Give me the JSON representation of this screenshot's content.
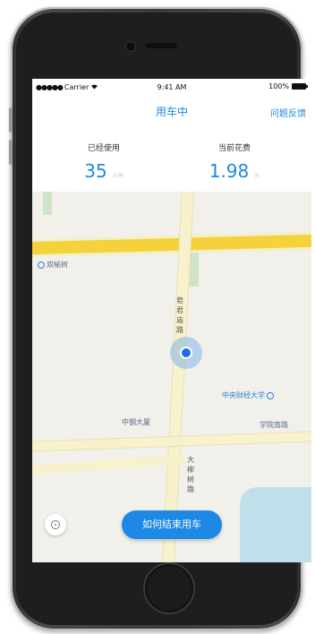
{
  "status_bar": {
    "carrier": "Carrier",
    "time": "9:41 AM",
    "battery": "100%"
  },
  "nav": {
    "title": "用车中",
    "feedback": "问题反馈"
  },
  "stats": {
    "used": {
      "label": "已经使用",
      "value": "35",
      "unit": "分钟"
    },
    "cost": {
      "label": "当前花费",
      "value": "1.98",
      "unit": "元"
    }
  },
  "map": {
    "labels": {
      "shuangyu": "双榆树",
      "central_univ": "中央财经大学",
      "zhongguancun": "中钢大厦",
      "xueyuan_south": "学院南路",
      "road_north": [
        "皂",
        "君",
        "庙",
        "路"
      ],
      "road_south": [
        "大",
        "柳",
        "树",
        "路"
      ]
    }
  },
  "actions": {
    "end_ride_help": "如何结束用车"
  }
}
